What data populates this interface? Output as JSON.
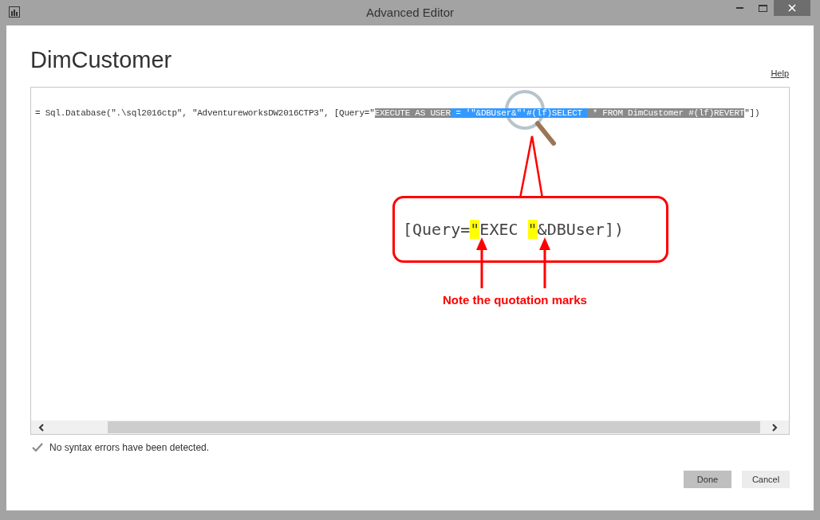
{
  "window": {
    "title": "Advanced Editor"
  },
  "heading": "DimCustomer",
  "help_link": "Help",
  "editor": {
    "code_segments": [
      {
        "text": "= Sql.Database(\".\\sql2016ctp\", \"AdventureworksDW2016CTP3\", [Query=\"",
        "kind": "plain"
      },
      {
        "text": "EXECUTE AS USER",
        "kind": "selected"
      },
      {
        "text": " = '\"&DBUser&\"'#(lf)SELECT ",
        "kind": "found"
      },
      {
        "text": " * FROM DimCustomer #(lf)REVERT",
        "kind": "selected"
      },
      {
        "text": "\"])",
        "kind": "plain"
      }
    ]
  },
  "annotation": {
    "callout_segments": [
      {
        "text": "[Query=",
        "highlighted": false
      },
      {
        "text": "\"",
        "highlighted": true
      },
      {
        "text": "EXEC ",
        "highlighted": false
      },
      {
        "text": "\"",
        "highlighted": true
      },
      {
        "text": "&DBUser])",
        "highlighted": false
      }
    ],
    "note": "Note the quotation marks"
  },
  "status": {
    "text": "No syntax errors have been detected."
  },
  "buttons": [
    {
      "label": "Done",
      "kind": "primary"
    },
    {
      "label": "Cancel",
      "kind": "secondary"
    }
  ]
}
